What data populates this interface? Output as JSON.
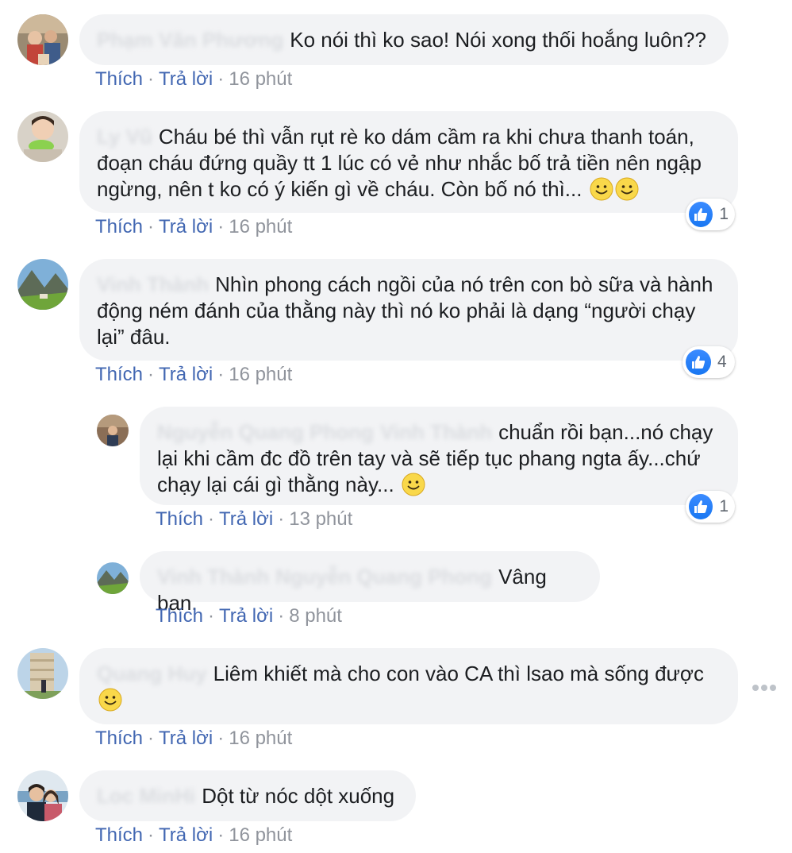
{
  "comments": [
    {
      "author": "Phạm Văn Phương",
      "text": "Ko nói thì ko sao! Nói xong thối hoắng luôn??",
      "like_label": "Thích",
      "reply_label": "Trả lời",
      "time": "16 phút"
    },
    {
      "author": "Ly Vũ",
      "text": "Cháu bé thì vẫn rụt rè ko dám cầm ra khi chưa thanh toán, đoạn cháu đứng quầy tt 1 lúc có vẻ như nhắc bố trả tiền nên ngập ngừng, nên t ko có ý kiến gì về cháu. Còn bố nó thì...",
      "like_label": "Thích",
      "reply_label": "Trả lời",
      "time": "16 phút",
      "reaction_count": "1"
    },
    {
      "author": "Vinh Thành",
      "text": "Nhìn phong cách ngồi của nó trên con bò sữa và hành động ném đánh của thằng này thì nó ko phải là dạng “người chạy lại” đâu.",
      "like_label": "Thích",
      "reply_label": "Trả lời",
      "time": "16 phút",
      "reaction_count": "4",
      "replies": [
        {
          "author": "Nguyễn Quang Phong",
          "mention": "Vinh Thành",
          "text": "chuẩn rồi bạn...nó chạy lại khi cầm đc đồ trên tay và sẽ tiếp tục phang ngta ấy...chứ chạy lại cái gì thằng này...",
          "like_label": "Thích",
          "reply_label": "Trả lời",
          "time": "13 phút",
          "reaction_count": "1"
        },
        {
          "author": "Vinh Thành",
          "mention": "Nguyễn Quang Phong",
          "text": "Vâng bạn.",
          "like_label": "Thích",
          "reply_label": "Trả lời",
          "time": "8 phút"
        }
      ]
    },
    {
      "author": "Quang Huy",
      "text": "Liêm khiết mà cho con vào CA thì lsao mà sống được",
      "like_label": "Thích",
      "reply_label": "Trả lời",
      "time": "16 phút"
    },
    {
      "author": "Loc MinHi",
      "text": "Dột từ nóc dột xuống",
      "like_label": "Thích",
      "reply_label": "Trả lời",
      "time": "16 phút"
    }
  ],
  "icons": {
    "reaction": "like-thumb-icon",
    "emoji": "smiley-emoji-icon",
    "more": "more-options-icon"
  },
  "colors": {
    "link": "#4267b2",
    "bubble": "#f2f3f5",
    "like_reaction": "#1877f2",
    "meta": "#90949c"
  }
}
